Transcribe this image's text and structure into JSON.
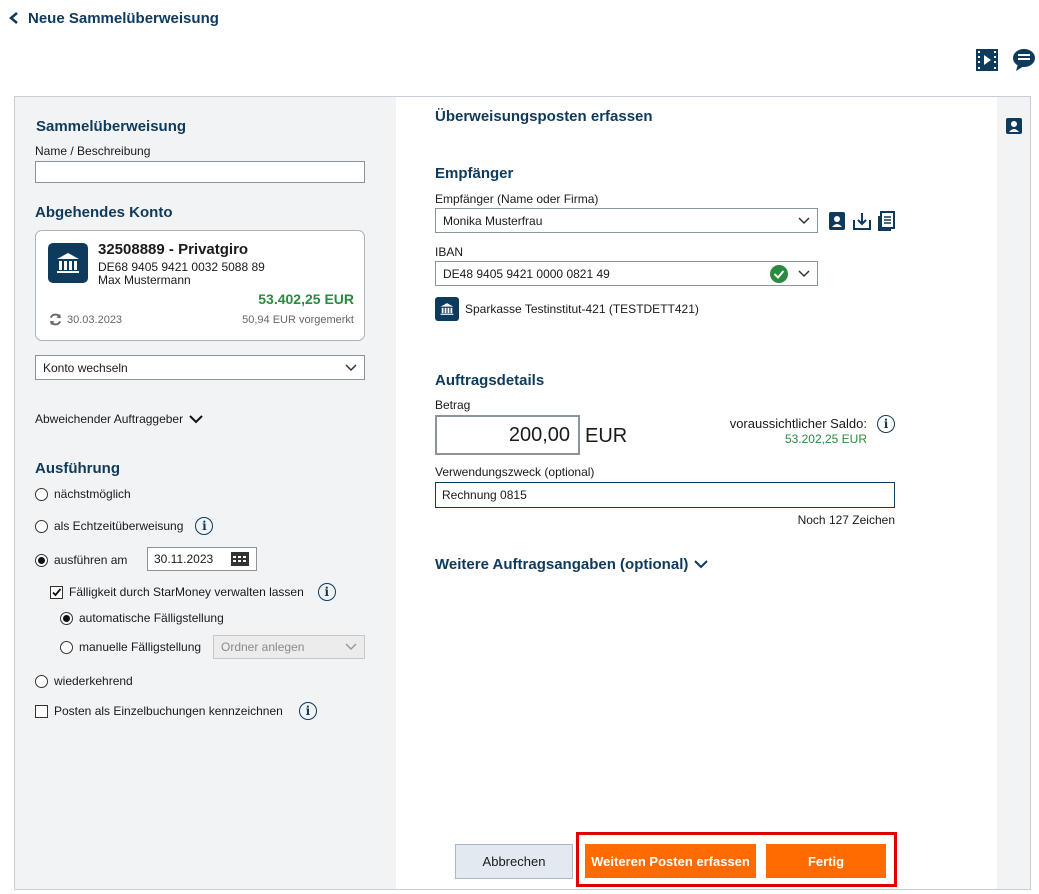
{
  "header": {
    "back_label": "Neue Sammelüberweisung"
  },
  "left": {
    "section_title": "Sammelüberweisung",
    "name_label": "Name / Beschreibung",
    "name_value": "",
    "account_title": "Abgehendes Konto",
    "account": {
      "number_name": "32508889 - Privatgiro",
      "iban": "DE68 9405 9421 0032 5088 89",
      "owner": "Max Mustermann",
      "balance": "53.402,25 EUR",
      "date": "30.03.2023",
      "reserved": "50,94 EUR vorgemerkt"
    },
    "switch_account": "Konto wechseln",
    "different_sender": "Abweichender Auftraggeber",
    "execution_title": "Ausführung",
    "options": {
      "asap": "nächstmöglich",
      "realtime": "als Echtzeitüberweisung",
      "execute_on": "ausführen am",
      "date_value": "30.11.2023",
      "due_manage": "Fälligkeit durch StarMoney verwalten lassen",
      "auto_due": "automatische Fälligstellung",
      "manual_due": "manuelle Fälligstellung",
      "folder_placeholder": "Ordner anlegen",
      "recurring": "wiederkehrend",
      "single_bookings": "Posten als Einzelbuchungen kennzeichnen"
    }
  },
  "right": {
    "title": "Überweisungsposten erfassen",
    "recipient_title": "Empfänger",
    "recipient_label": "Empfänger (Name oder Firma)",
    "recipient_value": "Monika Musterfrau",
    "iban_label": "IBAN",
    "iban_value": "DE48 9405 9421 0000 0821 49",
    "bank_name": "Sparkasse Testinstitut-421 (TESTDETT421)",
    "order_title": "Auftragsdetails",
    "amount_label": "Betrag",
    "amount_value": "200,00",
    "currency": "EUR",
    "forecast_label": "voraussichtlicher Saldo:",
    "forecast_value": "53.202,25 EUR",
    "purpose_label": "Verwendungszweck (optional)",
    "purpose_value": "Rechnung 0815",
    "remaining_chars": "Noch 127 Zeichen",
    "more_details": "Weitere Auftragsangaben (optional)"
  },
  "buttons": {
    "cancel": "Abbrechen",
    "more_items": "Weiteren Posten erfassen",
    "done": "Fertig"
  },
  "colors": {
    "navy": "#0e3a5c",
    "green": "#2a8a3e",
    "orange": "#ff6b00",
    "highlight": "#e00000"
  }
}
